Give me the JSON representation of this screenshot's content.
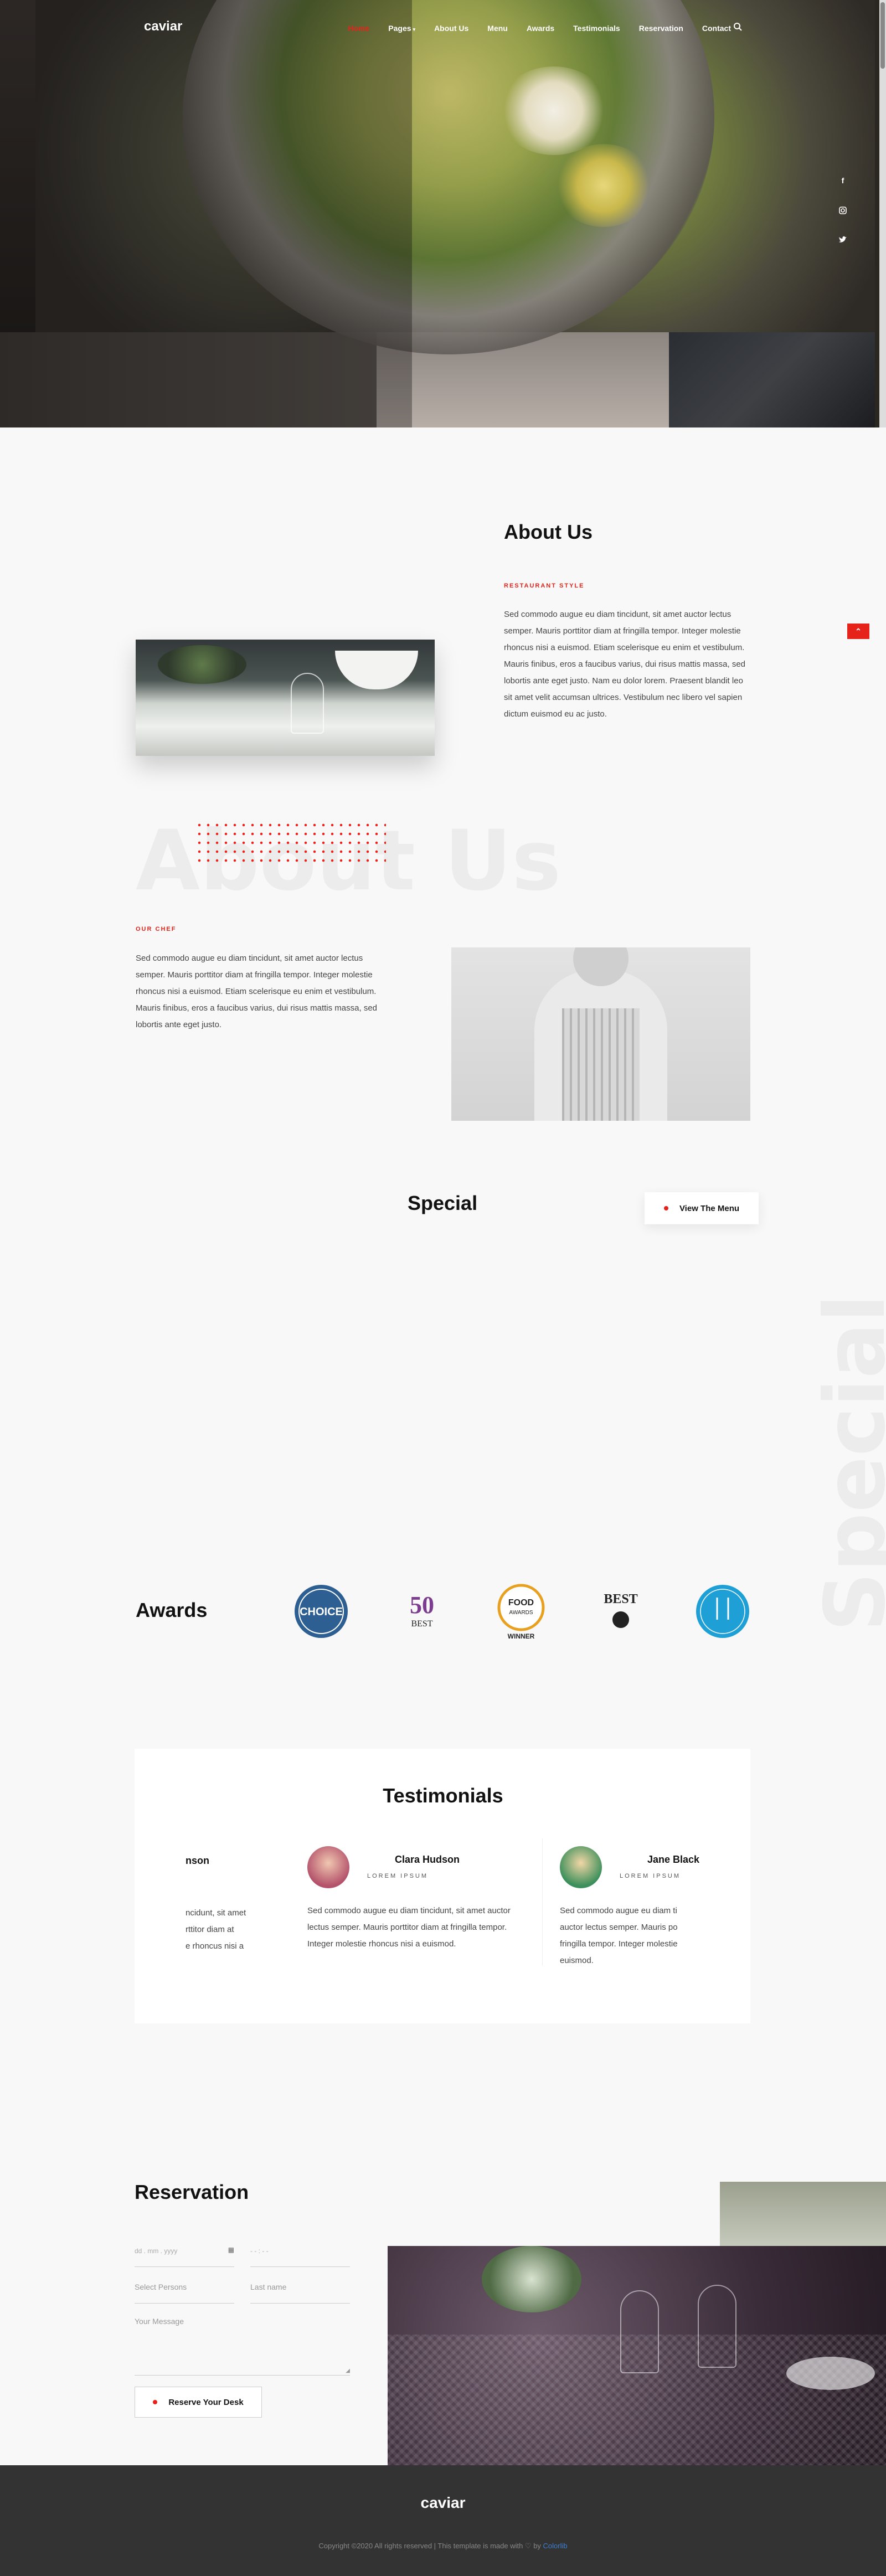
{
  "header": {
    "brand": "caviar",
    "nav": [
      {
        "label": "Home",
        "active": true
      },
      {
        "label": "Pages",
        "has_dropdown": true
      },
      {
        "label": "About Us"
      },
      {
        "label": "Menu"
      },
      {
        "label": "Awards"
      },
      {
        "label": "Testimonials"
      },
      {
        "label": "Reservation"
      },
      {
        "label": "Contact"
      }
    ],
    "search_icon": "search-icon",
    "social_icons": [
      "facebook-icon",
      "instagram-icon",
      "twitter-icon"
    ],
    "accent_color": "#e5231b"
  },
  "about": {
    "title": "About Us",
    "kicker": "RESTAURANT STYLE",
    "text": "Sed commodo augue eu diam tincidunt, sit amet auctor lectus semper. Mauris porttitor diam at fringilla tempor. Integer molestie rhoncus nisi a euismod. Etiam scelerisque eu enim et vestibulum. Mauris finibus, eros a faucibus varius, dui risus mattis massa, sed lobortis ante eget justo. Nam eu dolor lorem. Praesent blandit leo sit amet velit accumsan ultrices. Vestibulum nec libero vel sapien dictum euismod eu ac justo.",
    "watermark": "About Us"
  },
  "chef": {
    "kicker": "OUR CHEF",
    "text": "Sed commodo augue eu diam tincidunt, sit amet auctor lectus semper. Mauris porttitor diam at fringilla tempor. Integer molestie rhoncus nisi a euismod. Etiam scelerisque eu enim et vestibulum. Mauris finibus, eros a faucibus varius, dui risus mattis massa, sed lobortis ante eget justo."
  },
  "special": {
    "title": "Special",
    "button": "View The Menu",
    "watermark": "Special"
  },
  "awards": {
    "title": "Awards",
    "badges": [
      {
        "icon": "choice-award-badge-icon",
        "color": "#2d5f93"
      },
      {
        "icon": "50-best-badge-icon",
        "text": "50",
        "sub": "BEST",
        "color": "#7c3d8f"
      },
      {
        "icon": "food-awards-badge-icon",
        "text": "FOOD",
        "sub": "AWARDS",
        "caption": "WINNER",
        "color": "#e8a020"
      },
      {
        "icon": "best-restaurant-badge-icon",
        "text": "BEST",
        "color": "#222"
      },
      {
        "icon": "best-new-restaurant-badge-icon",
        "color": "#1ea0d6"
      }
    ]
  },
  "testimonials": {
    "title": "Testimonials",
    "items": [
      {
        "name": "nson",
        "sub": "",
        "text": "ncidunt, sit amet\nrttitor diam at\ne rhoncus nisi a"
      },
      {
        "name": "Clara Hudson",
        "sub": "LOREM IPSUM",
        "text": "Sed commodo augue eu diam tincidunt, sit amet auctor lectus semper. Mauris porttitor diam at fringilla tempor. Integer molestie rhoncus nisi a euismod."
      },
      {
        "name": "Jane Black",
        "sub": "LOREM IPSUM",
        "text": "Sed commodo augue eu diam ti\nauctor lectus semper. Mauris po\nfringilla tempor. Integer molestie\neuismod."
      }
    ]
  },
  "reservation": {
    "title": "Reservation",
    "date_placeholder": "dd . mm . yyyy",
    "time_placeholder": "- - : - -",
    "persons_placeholder": "Select Persons",
    "lastname_placeholder": "Last name",
    "message_placeholder": "Your Message",
    "button": "Reserve Your Desk"
  },
  "footer": {
    "brand": "caviar",
    "copyright": "Copyright ©2020 All rights reserved | This template is made with ♡ by",
    "credit": "Colorlib"
  }
}
